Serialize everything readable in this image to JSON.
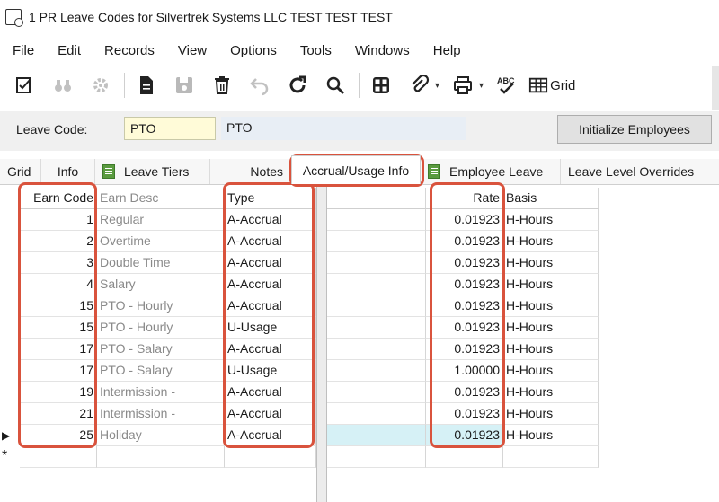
{
  "window": {
    "title": "1 PR Leave Codes for Silvertrek Systems LLC TEST TEST TEST",
    "icon": "document-gear-icon"
  },
  "menu": [
    "File",
    "Edit",
    "Records",
    "View",
    "Options",
    "Tools",
    "Windows",
    "Help"
  ],
  "toolbar": {
    "grid_label": "Grid",
    "icons": [
      "checklist-edit-icon",
      "binoculars-icon",
      "gear-icon",
      "new-document-icon",
      "save-icon",
      "delete-icon",
      "undo-icon",
      "refresh-icon",
      "search-icon",
      "calculator-icon",
      "attach-icon",
      "print-icon",
      "spellcheck-icon",
      "grid-icon"
    ]
  },
  "leave_code": {
    "label": "Leave Code:",
    "value": "PTO",
    "description": "PTO",
    "init_button": "Initialize Employees"
  },
  "tabs": [
    "Grid",
    "Info",
    "Leave Tiers",
    "Notes",
    "Accrual/Usage Info",
    "Employee Leave",
    "Leave Level Overrides"
  ],
  "active_tab": "Accrual/Usage Info",
  "columns": {
    "earn_code": "Earn Code",
    "earn_desc": "Earn Desc",
    "type": "Type",
    "rate": "Rate",
    "basis": "Basis"
  },
  "rows": [
    {
      "earn_code": "1",
      "earn_desc": "Regular",
      "type": "A-Accrual",
      "rate": "0.01923",
      "basis": "H-Hours"
    },
    {
      "earn_code": "2",
      "earn_desc": "Overtime",
      "type": "A-Accrual",
      "rate": "0.01923",
      "basis": "H-Hours"
    },
    {
      "earn_code": "3",
      "earn_desc": "Double Time",
      "type": "A-Accrual",
      "rate": "0.01923",
      "basis": "H-Hours"
    },
    {
      "earn_code": "4",
      "earn_desc": "Salary",
      "type": "A-Accrual",
      "rate": "0.01923",
      "basis": "H-Hours"
    },
    {
      "earn_code": "15",
      "earn_desc": "PTO - Hourly",
      "type": "A-Accrual",
      "rate": "0.01923",
      "basis": "H-Hours"
    },
    {
      "earn_code": "15",
      "earn_desc": "PTO - Hourly",
      "type": "U-Usage",
      "rate": "0.01923",
      "basis": "H-Hours"
    },
    {
      "earn_code": "17",
      "earn_desc": "PTO - Salary",
      "type": "A-Accrual",
      "rate": "0.01923",
      "basis": "H-Hours"
    },
    {
      "earn_code": "17",
      "earn_desc": "PTO - Salary",
      "type": "U-Usage",
      "rate": "1.00000",
      "basis": "H-Hours"
    },
    {
      "earn_code": "19",
      "earn_desc": "Intermission -",
      "type": "A-Accrual",
      "rate": "0.01923",
      "basis": "H-Hours"
    },
    {
      "earn_code": "21",
      "earn_desc": "Intermission -",
      "type": "A-Accrual",
      "rate": "0.01923",
      "basis": "H-Hours"
    },
    {
      "earn_code": "25",
      "earn_desc": "Holiday",
      "type": "A-Accrual",
      "rate": "0.01923",
      "basis": "H-Hours"
    }
  ],
  "row_markers": {
    "current": "▶",
    "new": "*"
  },
  "annotation_color": "#d9533d"
}
